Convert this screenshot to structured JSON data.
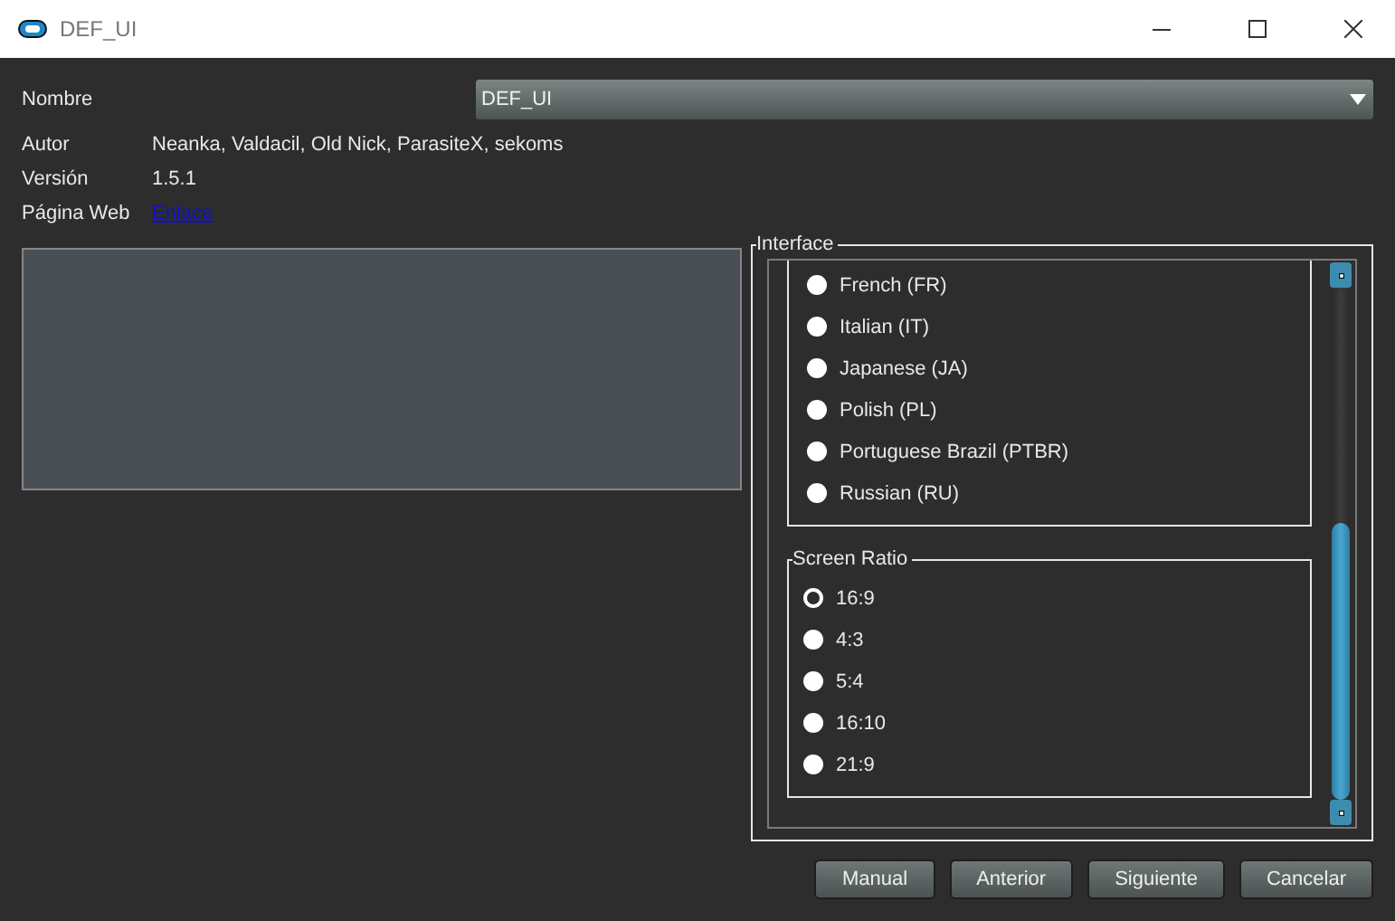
{
  "window": {
    "title": "DEF_UI"
  },
  "info": {
    "name_label": "Nombre",
    "name_value": "DEF_UI",
    "author_label": "Autor",
    "author": "Neanka, Valdacil, Old Nick, ParasiteX, sekoms",
    "version_label": "Versión",
    "version": "1.5.1",
    "web_label": "Página Web",
    "web_link": "Enlace"
  },
  "interface": {
    "title": "Interface",
    "languages": [
      {
        "label": "French (FR)",
        "selected": false
      },
      {
        "label": "Italian (IT)",
        "selected": false
      },
      {
        "label": "Japanese (JA)",
        "selected": false
      },
      {
        "label": "Polish (PL)",
        "selected": false
      },
      {
        "label": "Portuguese Brazil (PTBR)",
        "selected": false
      },
      {
        "label": "Russian (RU)",
        "selected": false
      }
    ],
    "screen_ratio": {
      "title": "Screen Ratio",
      "options": [
        {
          "label": "16:9",
          "selected": true
        },
        {
          "label": "4:3",
          "selected": false
        },
        {
          "label": "5:4",
          "selected": false
        },
        {
          "label": "16:10",
          "selected": false
        },
        {
          "label": "21:9",
          "selected": false
        }
      ]
    }
  },
  "buttons": [
    "Manual",
    "Anterior",
    "Siguiente",
    "Cancelar"
  ]
}
